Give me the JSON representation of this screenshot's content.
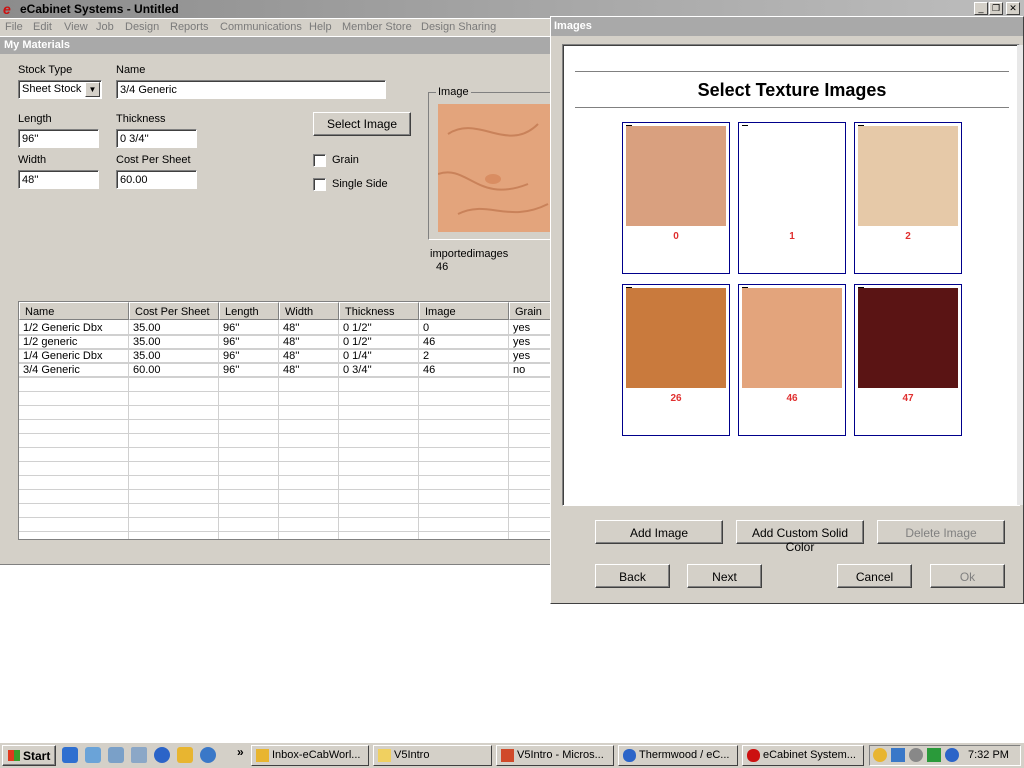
{
  "app": {
    "title": "eCabinet Systems - Untitled",
    "logo": "e",
    "window_controls": [
      "minimize-icon",
      "restore-icon",
      "close-icon"
    ]
  },
  "menu": [
    "File",
    "Edit",
    "View",
    "Job",
    "Design",
    "Reports",
    "Communications",
    "Help",
    "Member Store",
    "Design Sharing"
  ],
  "materials": {
    "panel_title": "My Materials",
    "stock_type_label": "Stock Type",
    "stock_type_value": "Sheet Stock",
    "name_label": "Name",
    "name_value": "3/4 Generic",
    "length_label": "Length",
    "length_value": "96''",
    "thickness_label": "Thickness",
    "thickness_value": "0 3/4''",
    "width_label": "Width",
    "width_value": "48''",
    "cost_label": "Cost Per Sheet",
    "cost_value": "60.00",
    "select_image_label": "Select Image",
    "grain_label": "Grain",
    "grain_checked": false,
    "single_side_label": "Single Side",
    "single_side_checked": false,
    "image_group_label": "Image",
    "image_source": "importedimages",
    "image_number": "46"
  },
  "table": {
    "columns": [
      "Name",
      "Cost Per Sheet",
      "Length",
      "Width",
      "Thickness",
      "Image",
      "Grain"
    ],
    "rows": [
      [
        "1/2 Generic Dbx",
        "35.00",
        "96''",
        "48''",
        "0 1/2''",
        "0",
        "yes"
      ],
      [
        "1/2 generic",
        "35.00",
        "96''",
        "48''",
        "0 1/2''",
        "46",
        "yes"
      ],
      [
        "1/4 Generic Dbx",
        "35.00",
        "96''",
        "48''",
        "0 1/4''",
        "2",
        "yes"
      ],
      [
        "3/4 Generic",
        "60.00",
        "96''",
        "48''",
        "0 3/4''",
        "46",
        "no"
      ]
    ]
  },
  "dialog": {
    "title": "Images",
    "heading": "Select Texture Images",
    "thumbnails": [
      {
        "label": "0",
        "color": "#d9a07f"
      },
      {
        "label": "1",
        "color": "#ffffff"
      },
      {
        "label": "2",
        "color": "#e6c9a8"
      },
      {
        "label": "26",
        "color": "#c97a3d"
      },
      {
        "label": "46",
        "color": "#e3a47c"
      },
      {
        "label": "47",
        "color": "#5a1414"
      }
    ],
    "buttons": {
      "add_image": "Add Image",
      "add_custom_color": "Add Custom Solid Color",
      "delete_image": "Delete Image",
      "back": "Back",
      "next": "Next",
      "cancel": "Cancel",
      "ok": "Ok"
    }
  },
  "taskbar": {
    "start": "Start",
    "overflow": "»",
    "tasks": [
      "Inbox-eCabWorl...",
      "V5Intro",
      "V5Intro - Micros...",
      "Thermwood / eC...",
      "eCabinet System..."
    ],
    "clock": "7:32 PM"
  },
  "colors": {
    "dialog_label_red": "#e03030",
    "thumb_border": "#00008b"
  }
}
